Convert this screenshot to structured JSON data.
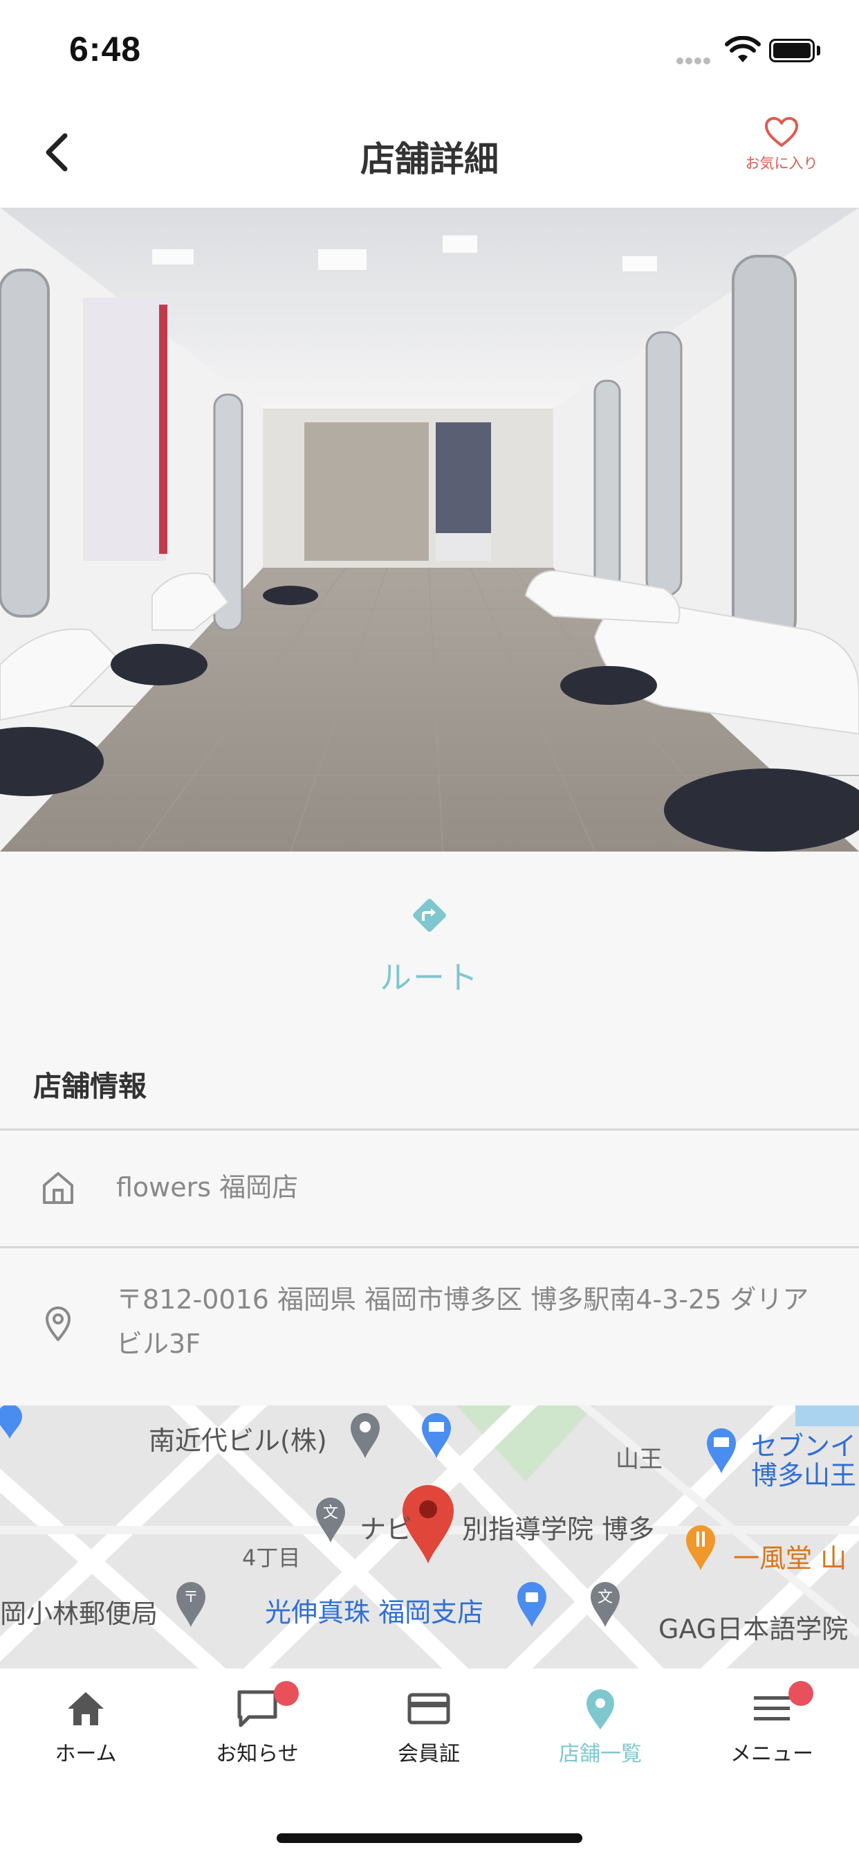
{
  "status": {
    "time": "6:48"
  },
  "header": {
    "title": "店舗詳細",
    "favorite_label": "お気に入り"
  },
  "route": {
    "label": "ルート"
  },
  "store_info": {
    "section_title": "店舗情報",
    "name": "flowers 福岡店",
    "address": "〒812-0016 福岡県 福岡市博多区 博多駅南4-3-25 ダリアビル3F"
  },
  "map": {
    "labels": [
      "南近代ビル(株)",
      "山王",
      "セブンイ",
      "博多山王",
      "ナビ",
      "別指導学院 博多",
      "4丁目",
      "一風堂 山",
      "岡小林郵便局",
      "光伸真珠 福岡支店",
      "GAG日本語学院"
    ]
  },
  "tabs": [
    {
      "label": "ホーム",
      "icon": "home-icon"
    },
    {
      "label": "お知らせ",
      "icon": "chat-icon",
      "badge": true
    },
    {
      "label": "会員証",
      "icon": "card-icon"
    },
    {
      "label": "店舗一覧",
      "icon": "location-pin-icon",
      "active": true
    },
    {
      "label": "メニュー",
      "icon": "menu-icon",
      "badge": true
    }
  ],
  "colors": {
    "accent": "#7fc7cf",
    "favorite": "#e05a50",
    "badge": "#e8505b"
  }
}
